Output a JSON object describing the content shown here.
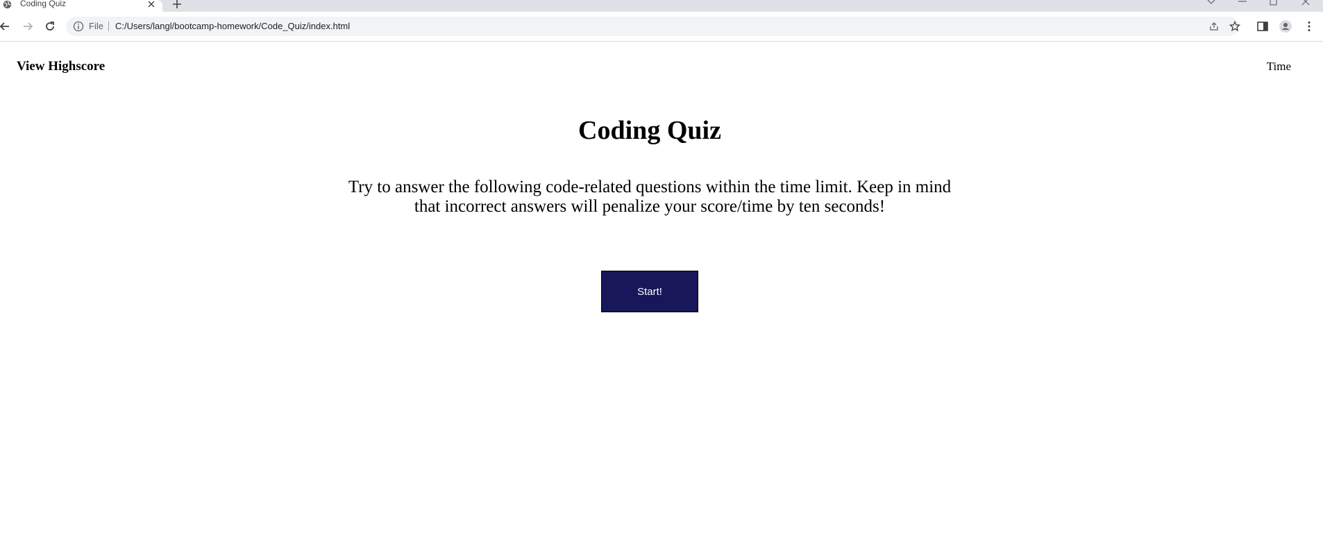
{
  "browser": {
    "tab_title": "Coding Quiz",
    "scheme_label": "File",
    "url": "C:/Users/langl/bootcamp-homework/Code_Quiz/index.html"
  },
  "page": {
    "nav_link": "View Highscore",
    "timer_label": "Time",
    "title": "Coding Quiz",
    "description": "Try to answer the following code-related questions within the time limit. Keep in mind that incorrect answers will penalize your score/time by ten seconds!",
    "start_button": "Start!"
  },
  "colors": {
    "start_button_bg": "#17175a",
    "start_button_text": "#ffffff",
    "tabstrip_bg": "#dee1e6",
    "omnibox_bg": "#f1f3f4"
  },
  "icons": {
    "favicon": "globe-icon",
    "tab_close": "close-icon",
    "new_tab": "plus-icon",
    "back": "back-arrow-icon",
    "forward": "forward-arrow-icon",
    "reload": "reload-icon",
    "site_info": "info-icon",
    "share": "share-icon",
    "bookmark": "star-icon",
    "side_panel": "side-panel-icon",
    "profile": "profile-icon",
    "menu": "kebab-menu-icon"
  }
}
